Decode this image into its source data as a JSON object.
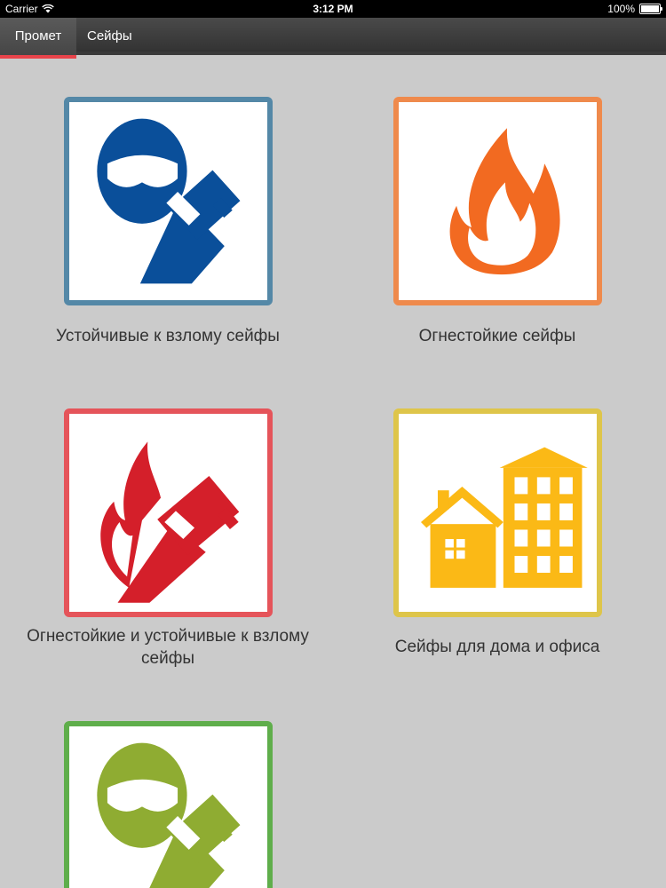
{
  "status_bar": {
    "carrier": "Carrier",
    "time": "3:12 PM",
    "battery": "100%"
  },
  "tabs": [
    {
      "label": "Промет",
      "active": true
    },
    {
      "label": "Сейфы",
      "active": false
    }
  ],
  "categories": [
    {
      "label": "Устойчивые к взлому сейфы",
      "icon": "burglar-hammer-icon",
      "color": "#0a4f9a",
      "border": "#5488a7"
    },
    {
      "label": "Огнестойкие сейфы",
      "icon": "flame-icon",
      "color": "#f26a21",
      "border": "#ef8a4c"
    },
    {
      "label": "Огнестойкие и устойчивые к взлому сейфы",
      "icon": "flame-hammer-icon",
      "color": "#d41f2a",
      "border": "#e5545a"
    },
    {
      "label": "Сейфы для дома и офиса",
      "icon": "house-building-icon",
      "color": "#fbb916",
      "border": "#dec54a"
    },
    {
      "label": "",
      "icon": "burglar-hammer-icon",
      "color": "#8fac32",
      "border": "#5fae4b"
    }
  ],
  "colors": {
    "background": "#cbcbcb",
    "tab_indicator": "#e8434a"
  }
}
